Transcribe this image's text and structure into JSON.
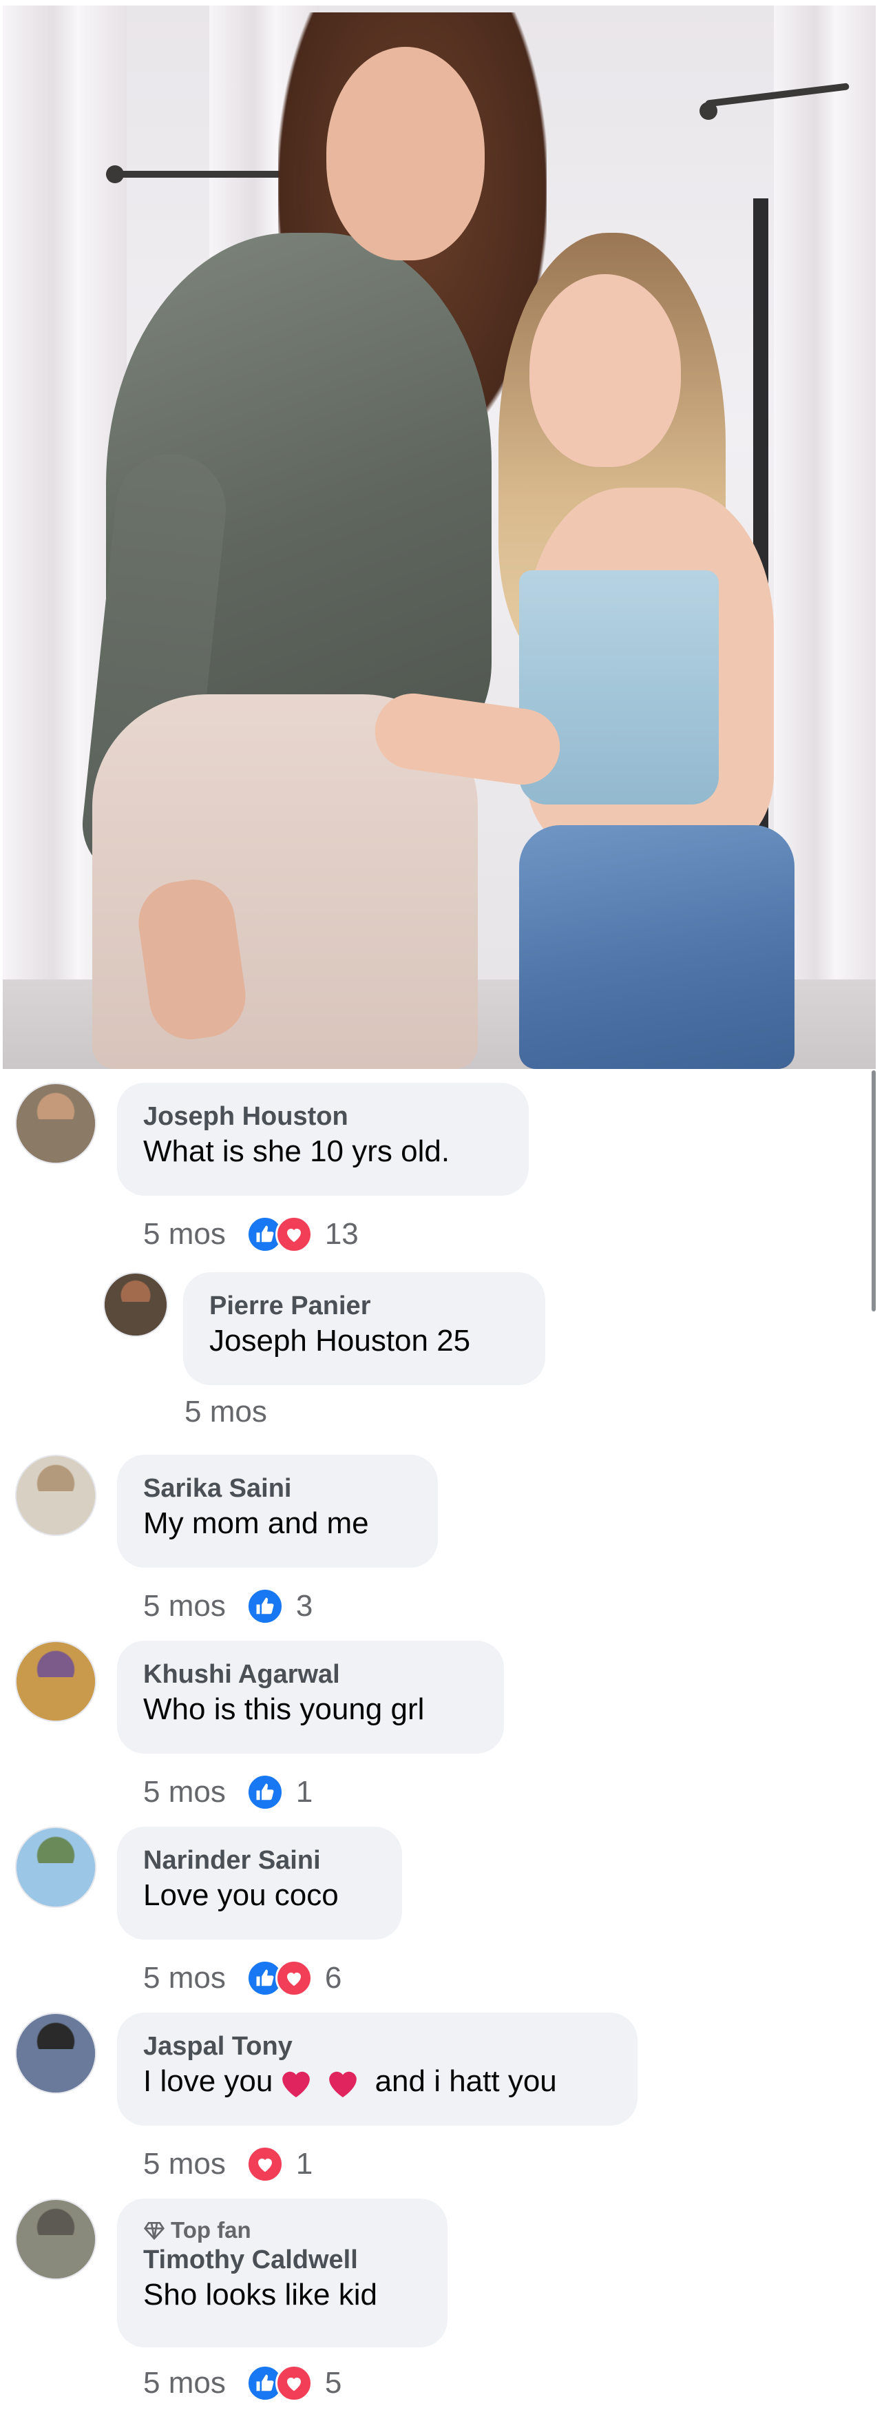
{
  "post_image": {
    "alt": ""
  },
  "comments": [
    {
      "author": "Joseph Houston",
      "text": "What is she 10 yrs old.",
      "time": "5 mos",
      "reactions": [
        "like",
        "love"
      ],
      "reaction_count": "13",
      "avatar_colors": [
        "#8a7a66",
        "#c49a7a"
      ],
      "replies": [
        {
          "author": "Pierre Panier",
          "text": "Joseph Houston 25",
          "time": "5 mos",
          "avatar_colors": [
            "#5a4a3c",
            "#a36b4e"
          ]
        }
      ]
    },
    {
      "author": "Sarika Saini",
      "text": "My mom and me",
      "time": "5 mos",
      "reactions": [
        "like"
      ],
      "reaction_count": "3",
      "avatar_colors": [
        "#d8d0c2",
        "#b49a7c"
      ]
    },
    {
      "author": "Khushi Agarwal",
      "text": "Who is this young grl",
      "time": "5 mos",
      "reactions": [
        "like"
      ],
      "reaction_count": "1",
      "avatar_colors": [
        "#c99a4b",
        "#7c5a8a"
      ]
    },
    {
      "author": "Narinder Saini",
      "text": "Love you coco",
      "time": "5 mos",
      "reactions": [
        "like",
        "love"
      ],
      "reaction_count": "6",
      "avatar_colors": [
        "#9cc6e6",
        "#6b8a5a"
      ]
    },
    {
      "author": "Jaspal Tony",
      "text_before": "I love you",
      "text_after": "and i hatt you",
      "time": "5 mos",
      "reactions": [
        "love"
      ],
      "reaction_count": "1",
      "avatar_colors": [
        "#6a7a9a",
        "#2a2a2a"
      ]
    },
    {
      "badge": "Top fan",
      "author": "Timothy Caldwell",
      "text": "Sho looks like kid",
      "time": "5 mos",
      "reactions": [
        "like",
        "love"
      ],
      "reaction_count": "5",
      "avatar_colors": [
        "#8a8a7c",
        "#5c5a52"
      ]
    }
  ],
  "colors": {
    "like": "#1877f2",
    "love": "#f33e58",
    "bubble": "#f0f2f5",
    "meta": "#65676b"
  }
}
